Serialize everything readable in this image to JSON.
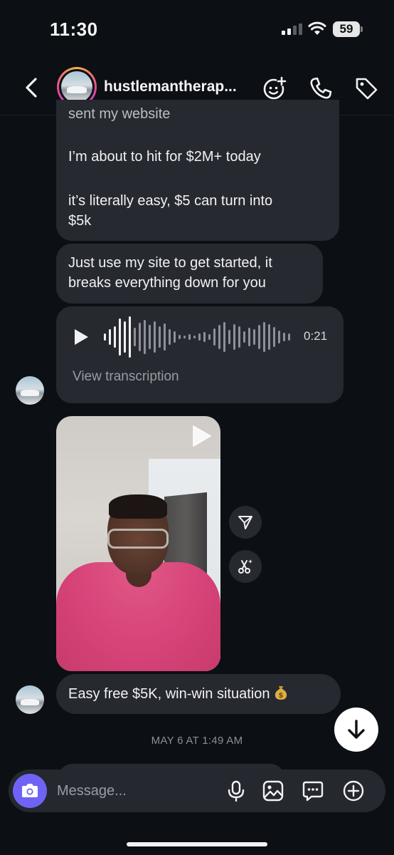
{
  "status_bar": {
    "time": "11:30",
    "battery": "59"
  },
  "header": {
    "username": "hustlemantherap..."
  },
  "messages": {
    "cut_line": "sent my website",
    "line_hit": "I’m about to hit for $2M+ today",
    "line_easy_1": "it’s literally easy, $5 can turn into",
    "line_easy_2": "$5k",
    "site_1": "Just use my site to get started, it",
    "site_2": "breaks everything down for you",
    "voice_duration": "0:21",
    "view_transcription": "View transcription",
    "last_message": "Easy free $5K, win-win situation"
  },
  "timestamp": "MAY 6 AT 1:49 AM",
  "composer": {
    "placeholder": "Message..."
  },
  "icons": {
    "back": "chevron-left-icon",
    "effects": "face-plus-icon",
    "call": "phone-icon",
    "tag": "tag-icon",
    "camera": "camera-icon",
    "mic": "microphone-icon",
    "gallery": "image-icon",
    "sticker": "chat-dots-icon",
    "plus": "plus-circle-icon",
    "share": "paper-plane-icon",
    "remix": "scissors-sparkle-icon",
    "play": "play-icon",
    "scroll": "arrow-down-icon",
    "emoji": "money-bag-emoji"
  },
  "colors": {
    "background": "#0c0f14",
    "bubble": "#26292f",
    "accent": "#6f63f5"
  }
}
